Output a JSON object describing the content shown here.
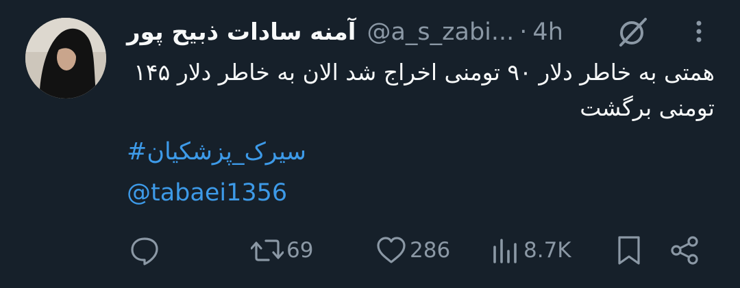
{
  "tweet": {
    "display_name": "آمنه سادات ذبیح پور",
    "handle": "@a_s_zabi...",
    "separator": "·",
    "time": "4h",
    "text": "همتی به خاطر دلار ۹۰ تومنی اخراج شد الان به خاطر دلار ۱۴۵ تومنی برگشت",
    "hashtag": "سیرک_پزشکیان#",
    "mention": "@tabaei1356"
  },
  "actions": {
    "reply": {
      "icon": "reply-icon",
      "count": ""
    },
    "retweet": {
      "icon": "retweet-icon",
      "count": "69"
    },
    "like": {
      "icon": "heart-icon",
      "count": "286"
    },
    "views": {
      "icon": "analytics-icon",
      "count": "8.7K"
    },
    "bookmark": {
      "icon": "bookmark-icon"
    },
    "share": {
      "icon": "share-icon"
    }
  },
  "colors": {
    "background": "#16202a",
    "text": "#f7f9f9",
    "muted": "#8b98a5",
    "link": "#3d9ae8"
  }
}
